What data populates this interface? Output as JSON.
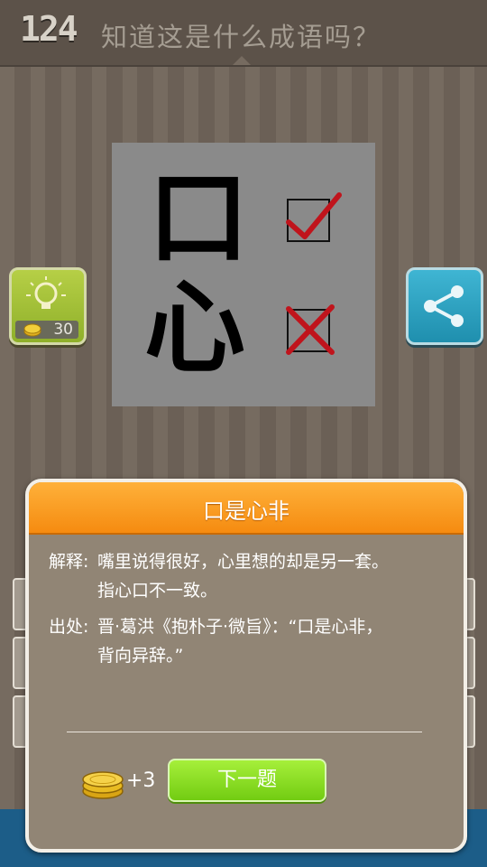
{
  "header": {
    "level": "124",
    "question": "知道这是什么成语吗？"
  },
  "puzzle": {
    "char_top": "口",
    "char_bottom": "心",
    "mark_top": "check",
    "mark_bottom": "cross",
    "mark_color": "#c0141c"
  },
  "hint_button": {
    "icon": "lightbulb-icon",
    "cost": "30"
  },
  "share_button": {
    "icon": "share-icon"
  },
  "modal": {
    "title": "口是心非",
    "explanation_label": "解释:",
    "explanation_line1": "嘴里说得很好，心里想的却是另一套。",
    "explanation_line2": "指心口不一致。",
    "source_label": "出处:",
    "source_line1": "晋·葛洪《抱朴子·微旨》：“口是心非，",
    "source_line2": "背向异辞。”",
    "reward": "+3",
    "next_label": "下一题"
  },
  "colors": {
    "header_orange": "#f58b10",
    "next_green": "#7fd41a",
    "hint_green": "#a3c23a",
    "share_blue": "#2aa3c4"
  }
}
